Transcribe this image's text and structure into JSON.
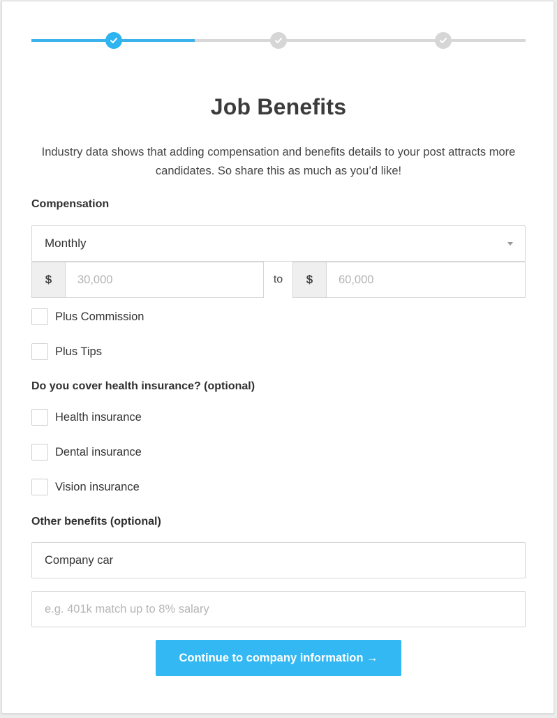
{
  "progress": {
    "steps": [
      {
        "state": "complete-active"
      },
      {
        "state": "pending"
      },
      {
        "state": "pending"
      }
    ],
    "completed_fraction": 0.33
  },
  "title": "Job Benefits",
  "intro": "Industry data shows that adding compensation and benefits details to your post attracts more candidates. So share this as much as you’d like!",
  "compensation": {
    "label": "Compensation",
    "period": "Monthly",
    "currency_symbol": "$",
    "min_placeholder": "30,000",
    "max_placeholder": "60,000",
    "to_label": "to",
    "extras": [
      "Plus Commission",
      "Plus Tips"
    ]
  },
  "health": {
    "label": "Do you cover health insurance? (optional)",
    "options": [
      "Health insurance",
      "Dental insurance",
      "Vision insurance"
    ]
  },
  "other_benefits": {
    "label": "Other benefits (optional)",
    "value": "Company car",
    "placeholder": "e.g. 401k match up to 8% salary"
  },
  "continue_label": "Continue to company information →",
  "colors": {
    "accent": "#33b8f3",
    "pending": "#d6d6d6"
  }
}
